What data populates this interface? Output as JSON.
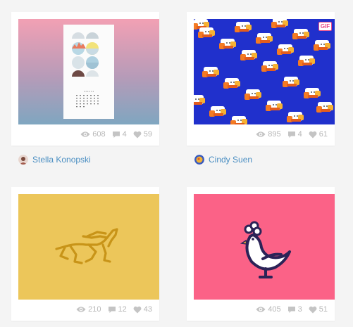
{
  "shots": [
    {
      "id": "shot-1",
      "views": "608",
      "comments": "4",
      "likes": "59",
      "author": "Stella Konopski"
    },
    {
      "id": "shot-2",
      "views": "895",
      "comments": "4",
      "likes": "61",
      "author": "Cindy Suen",
      "badge": "GIF"
    },
    {
      "id": "shot-3",
      "views": "210",
      "comments": "12",
      "likes": "43"
    },
    {
      "id": "shot-4",
      "views": "405",
      "comments": "3",
      "likes": "51"
    }
  ],
  "colors": {
    "link": "#4a8ec2",
    "stat_text": "#b7b7b7",
    "shot3_bg": "#ecc65a",
    "shot4_bg": "#fb6287",
    "shot2_bg": "#2030cc"
  },
  "icons": [
    "eye-icon",
    "comment-icon",
    "heart-icon"
  ]
}
